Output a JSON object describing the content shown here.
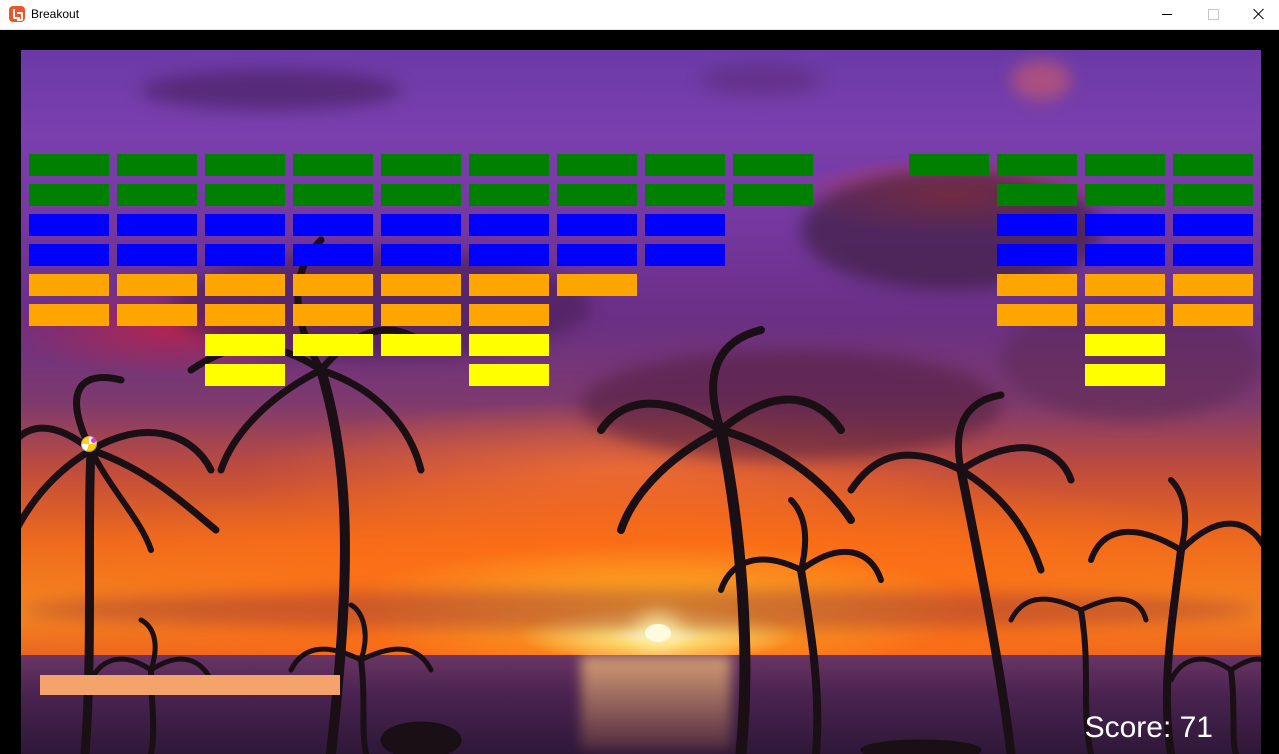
{
  "window": {
    "title": "Breakout",
    "icon": "monogame-icon"
  },
  "title_bar_buttons": [
    "minimize-icon",
    "maximize-icon",
    "close-icon"
  ],
  "game": {
    "score_label": "Score: 71",
    "colors": {
      "green": "#008000",
      "blue": "#0000ff",
      "orange": "#ffa500",
      "yellow": "#ffff00",
      "paddle": "#f4a46b",
      "score_text": "#ffffff"
    },
    "brick_grid": {
      "columns": 14,
      "row_colors": [
        "green",
        "green",
        "blue",
        "blue",
        "orange",
        "orange",
        "yellow",
        "yellow"
      ],
      "present": [
        [
          1,
          1,
          1,
          1,
          1,
          1,
          1,
          1,
          1,
          0,
          1,
          1,
          1,
          1
        ],
        [
          1,
          1,
          1,
          1,
          1,
          1,
          1,
          1,
          1,
          0,
          0,
          1,
          1,
          1
        ],
        [
          1,
          1,
          1,
          1,
          1,
          1,
          1,
          1,
          0,
          0,
          0,
          1,
          1,
          1
        ],
        [
          1,
          1,
          1,
          1,
          1,
          1,
          1,
          1,
          0,
          0,
          0,
          1,
          1,
          1
        ],
        [
          1,
          1,
          1,
          1,
          1,
          1,
          1,
          0,
          0,
          0,
          0,
          1,
          1,
          1
        ],
        [
          1,
          1,
          1,
          1,
          1,
          1,
          0,
          0,
          0,
          0,
          0,
          1,
          1,
          1
        ],
        [
          0,
          0,
          1,
          1,
          1,
          1,
          0,
          0,
          0,
          0,
          0,
          0,
          1,
          0
        ],
        [
          0,
          0,
          1,
          0,
          0,
          1,
          0,
          0,
          0,
          0,
          0,
          0,
          1,
          0
        ]
      ]
    }
  }
}
